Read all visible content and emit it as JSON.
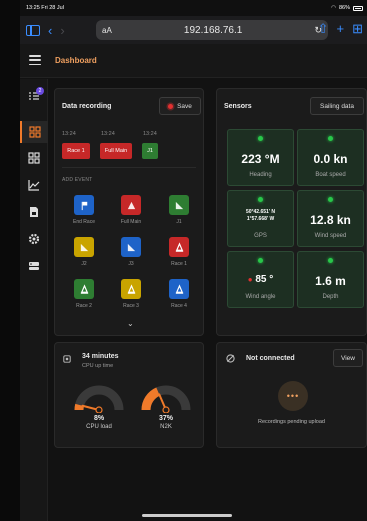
{
  "status_bar": {
    "time": "13:25",
    "date": "Fri 28 Jul",
    "battery": "86%"
  },
  "browser": {
    "text_size_label": "aA",
    "url": "192.168.76.1"
  },
  "app": {
    "title": "Dashboard",
    "notification_count": "2"
  },
  "data_recording": {
    "title": "Data recording",
    "save_label": "Save",
    "recent": [
      {
        "time": "13:24",
        "label": "Race 1",
        "color": "#c62828"
      },
      {
        "time": "13:24",
        "label": "Full Main",
        "color": "#c62828"
      },
      {
        "time": "13:24",
        "label": "J1",
        "color": "#2e7d32"
      }
    ],
    "add_event_label": "ADD EVENT",
    "events": [
      {
        "label": "End Race",
        "color": "#1e63c8",
        "icon": "flag-icon"
      },
      {
        "label": "Full Main",
        "color": "#c62828",
        "icon": "sail-icon"
      },
      {
        "label": "J1",
        "color": "#2e7d32",
        "icon": "jib-icon"
      },
      {
        "label": "J2",
        "color": "#c9a400",
        "icon": "jib-icon"
      },
      {
        "label": "J3",
        "color": "#1e63c8",
        "icon": "jib-icon"
      },
      {
        "label": "Race 1",
        "color": "#c62828",
        "icon": "buoy-icon"
      },
      {
        "label": "Race 2",
        "color": "#2e7d32",
        "icon": "buoy-icon"
      },
      {
        "label": "Race 3",
        "color": "#c9a400",
        "icon": "buoy-icon"
      },
      {
        "label": "Race 4",
        "color": "#1e63c8",
        "icon": "buoy-icon"
      }
    ]
  },
  "sensors": {
    "title": "Sensors",
    "sailing_data_label": "Sailing data",
    "items": [
      {
        "value": "223 °M",
        "label": "Heading"
      },
      {
        "value": "0.0 kn",
        "label": "Boat speed"
      },
      {
        "value_line1": "50°42.651' N",
        "value_line2": "1°57.668' W",
        "label": "GPS"
      },
      {
        "value": "12.8 kn",
        "label": "Wind speed"
      },
      {
        "value": "85 °",
        "label": "Wind angle",
        "side": "port"
      },
      {
        "value": "1.6 m",
        "label": "Depth"
      }
    ]
  },
  "system": {
    "uptime_value": "34 minutes",
    "uptime_label": "CPU up time",
    "cpu_load_value": "8%",
    "cpu_load_fraction": 0.08,
    "cpu_load_label": "CPU load",
    "n2k_value": "37%",
    "n2k_fraction": 0.37,
    "n2k_label": "N2K",
    "accent": "#f07a2a"
  },
  "upload": {
    "status": "Not connected",
    "view_label": "View",
    "pending_label": "Recordings pending upload"
  }
}
